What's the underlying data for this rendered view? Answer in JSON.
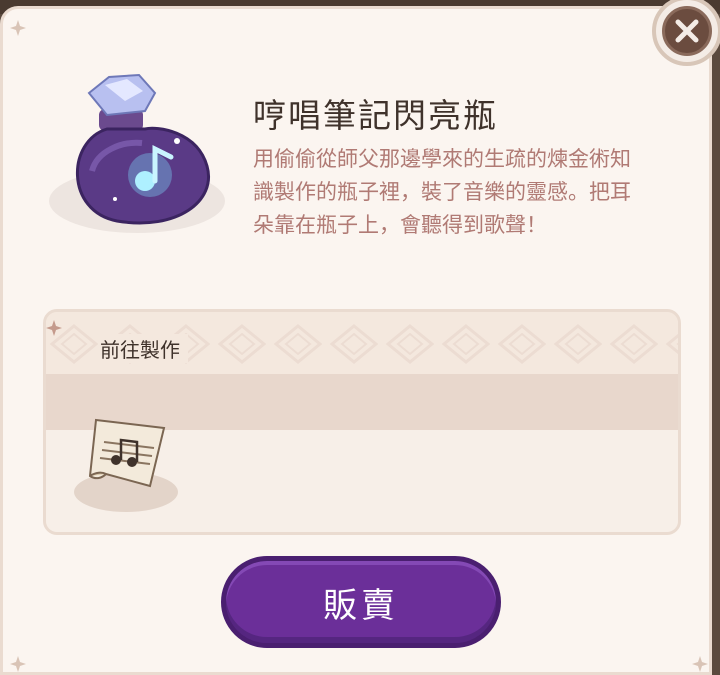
{
  "item": {
    "name": "哼唱筆記閃亮瓶",
    "description_lines": [
      "用偷偷從師父那邊學來的生疏的煉金術知",
      "識製作的瓶子裡，裝了音樂的靈感。把耳",
      "朵靠在瓶子上，會聽得到歌聲！"
    ],
    "icon": "purple-music-potion-bottle-icon"
  },
  "craft": {
    "label": "前往製作",
    "recipe_icon": "music-sheet-icon"
  },
  "actions": {
    "sell_label": "販賣",
    "close_icon": "close-icon"
  },
  "colors": {
    "accent": "#6b2f99",
    "title": "#3f322b",
    "description": "#b07a74",
    "panel": "#fbf5f0"
  }
}
